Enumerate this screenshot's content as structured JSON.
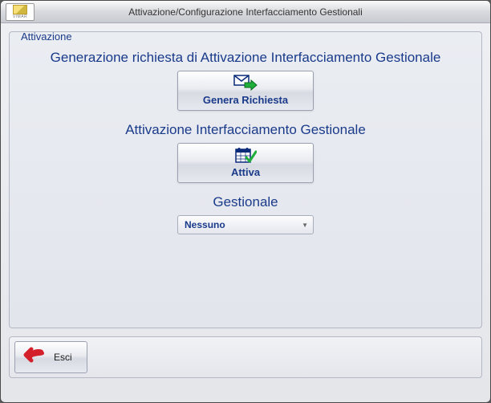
{
  "window": {
    "title": "Attivazione/Configurazione Interfacciamento Gestionali",
    "brand": "VIMAR"
  },
  "groupbox": {
    "title": "Attivazione"
  },
  "section_generate": {
    "heading": "Generazione richiesta di Attivazione Interfacciamento Gestionale",
    "button_label": "Genera Richiesta"
  },
  "section_activate": {
    "heading": "Attivazione Interfacciamento Gestionale",
    "button_label": "Attiva"
  },
  "section_gestionale": {
    "heading": "Gestionale",
    "selected": "Nessuno"
  },
  "bottom": {
    "esc_label": "Esci"
  }
}
